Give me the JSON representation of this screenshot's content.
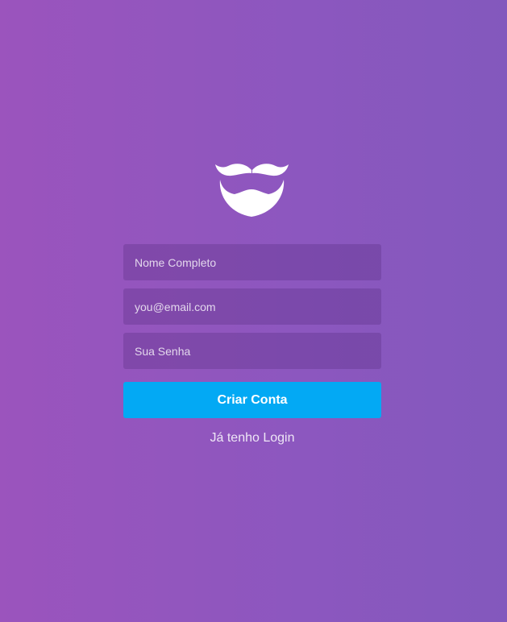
{
  "logo": {
    "icon": "mustache-beard-icon"
  },
  "form": {
    "name_placeholder": "Nome Completo",
    "email_placeholder": "you@email.com",
    "password_placeholder": "Sua Senha",
    "submit_label": "Criar Conta",
    "login_link": "Já tenho Login"
  },
  "colors": {
    "background_start": "#9b54bd",
    "background_end": "#8358bd",
    "button": "#03a9f4"
  }
}
